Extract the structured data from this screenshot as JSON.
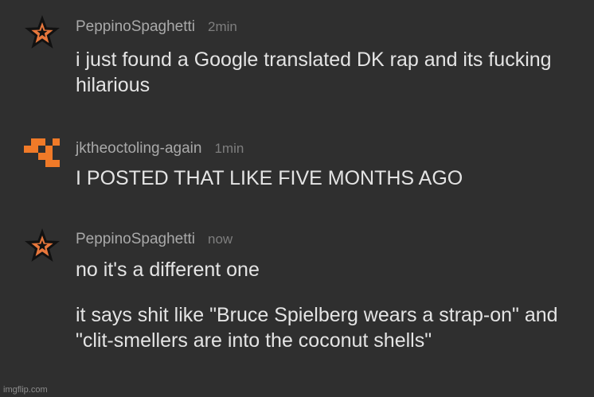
{
  "messages": [
    {
      "avatar_icon": "star-icon",
      "username": "PeppinoSpaghetti",
      "time": "2min",
      "lines": [
        "i just found a Google translated DK rap and its fucking hilarious"
      ]
    },
    {
      "avatar_icon": "pixel-block-icon",
      "username": "jktheoctoling-again",
      "time": "1min",
      "lines": [
        "I POSTED THAT LIKE FIVE MONTHS AGO"
      ]
    },
    {
      "avatar_icon": "star-icon",
      "username": "PeppinoSpaghetti",
      "time": "now",
      "lines": [
        "no it's a different one",
        "it says shit like \"Bruce Spielberg wears a strap-on\" and \"clit-smellers are into the coconut shells\""
      ]
    }
  ],
  "watermark": "imgflip.com",
  "colors": {
    "background": "#2f2f2f",
    "username": "#a9a9a9",
    "timestamp": "#7e7e7e",
    "message_text": "#e4e4e4",
    "star_fill": "#e8773c",
    "pixel_avatar": "#f07a28"
  }
}
